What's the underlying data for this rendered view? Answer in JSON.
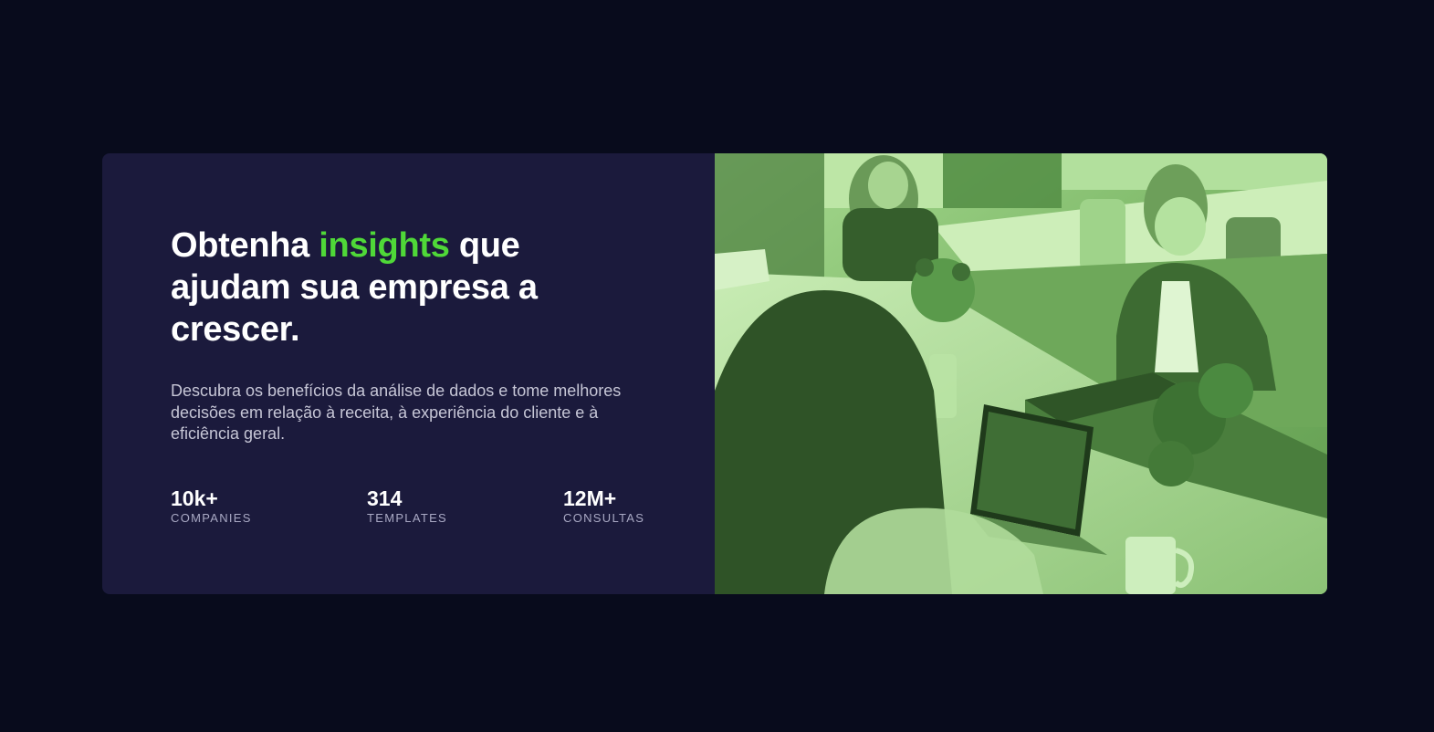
{
  "hero": {
    "headline_pre": "Obtenha ",
    "headline_accent": "insights",
    "headline_post": " que ajudam sua empresa a crescer.",
    "description": "Descubra os benefícios da análise de dados e tome melhores decisões em relação à receita, à experiência do cliente e à eficiência geral."
  },
  "stats": [
    {
      "value": "10k+",
      "label": "COMPANIES"
    },
    {
      "value": "314",
      "label": "TEMPLATES"
    },
    {
      "value": "12M+",
      "label": "CONSULTAS"
    }
  ],
  "colors": {
    "page_background": "#080b1c",
    "card_background": "#1b1a3c",
    "accent": "#4fd838",
    "image_tint": "#6aa55a"
  },
  "image": {
    "subject": "people-working-at-office-desk-photo"
  }
}
